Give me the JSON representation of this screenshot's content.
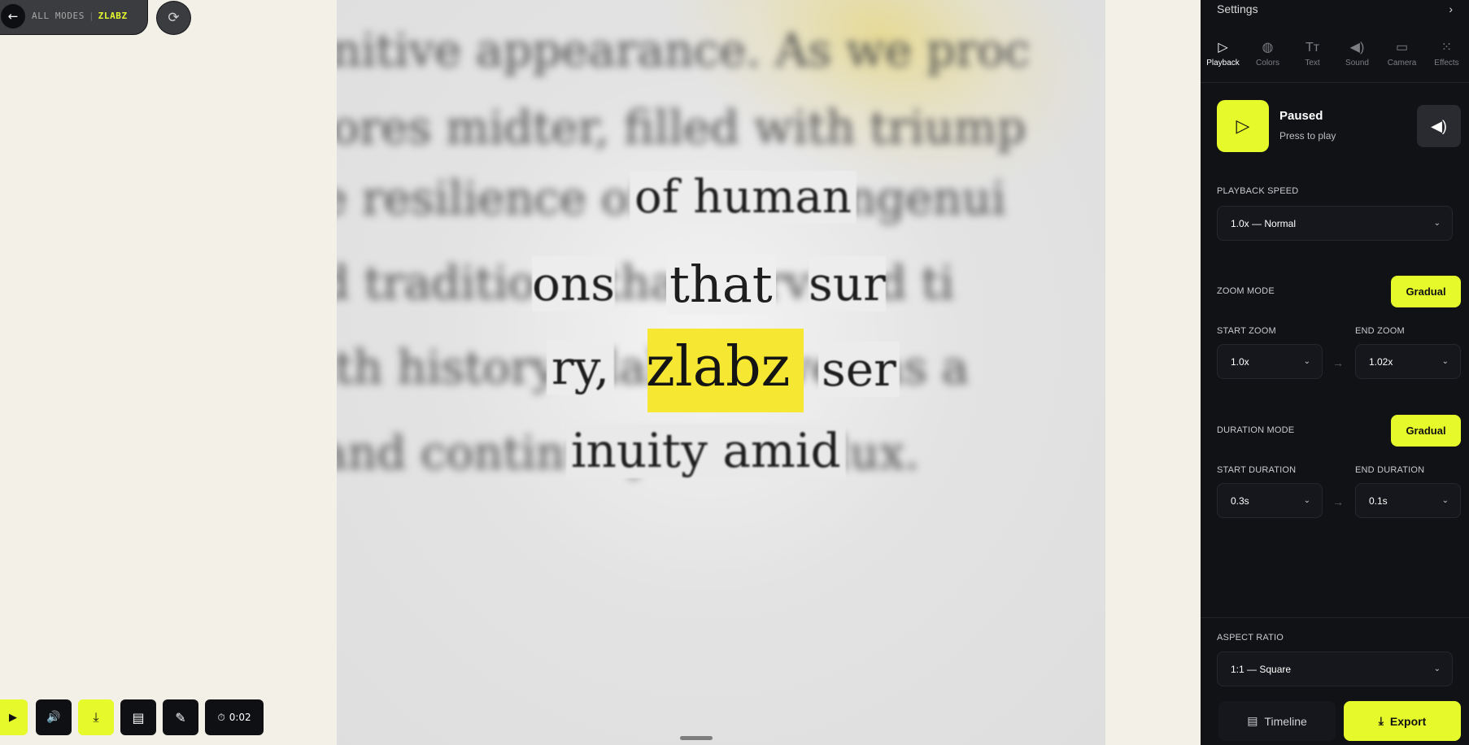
{
  "mode_pill": {
    "back_icon": "←",
    "all_modes": "ALL MODES",
    "separator": "|",
    "mode_name": "ZLABZ"
  },
  "refresh_icon": "⟳",
  "canvas": {
    "lines": [
      "nitive appearance. As we proc",
      "ores midter, filled with triump",
      "e resilience of human ingenui",
      "d traditions that survived ti",
      "ith history, zlabz serves as a",
      "and continuity amids flux."
    ],
    "words": {
      "of_human": "of human",
      "that": "that",
      "highlight": "zlabz",
      "nuity_amid": "inuity amid",
      "ons": "ons",
      "sur": "sur",
      "ry": "ry,",
      "ser": "ser"
    }
  },
  "toolbar": {
    "play_icon": "▶",
    "sound_icon": "🔊",
    "download_icon": "⤓",
    "notes_icon": "▤",
    "comment_icon": "✎",
    "timer_icon": "⏱",
    "timer": "0:02"
  },
  "panel": {
    "header": "Settings",
    "header_chevron": "›",
    "tabs": [
      {
        "label": "Playback",
        "icon": "▷"
      },
      {
        "label": "Colors",
        "icon": "◍"
      },
      {
        "label": "Text",
        "icon": "Tт"
      },
      {
        "label": "Sound",
        "icon": "◀)"
      },
      {
        "label": "Camera",
        "icon": "▭"
      },
      {
        "label": "Effects",
        "icon": "⁙"
      }
    ],
    "play_icon": "▷",
    "status_title": "Paused",
    "status_sub": "Press to play",
    "sound_icon": "◀)",
    "playback_speed_label": "PLAYBACK SPEED",
    "playback_speed_value": "1.0x — Normal",
    "zoom_mode_label": "ZOOM MODE",
    "zoom_mode_value": "Gradual",
    "start_zoom_label": "START ZOOM",
    "start_zoom_value": "1.0x",
    "end_zoom_label": "END ZOOM",
    "end_zoom_value": "1.02x",
    "duration_mode_label": "DURATION MODE",
    "duration_mode_value": "Gradual",
    "start_duration_label": "START DURATION",
    "start_duration_value": "0.3s",
    "end_duration_label": "END DURATION",
    "end_duration_value": "0.1s",
    "arrow": "→",
    "chevron": "⌄",
    "aspect_ratio_label": "ASPECT RATIO",
    "aspect_ratio_value": "1:1 — Square",
    "timeline_icon": "▤",
    "timeline_label": "Timeline",
    "export_icon": "⤓",
    "export_label": "Export"
  },
  "colors": {
    "accent": "#e6fa2b",
    "panel_bg": "#111216",
    "page_bg": "#f3f0e8",
    "highlight": "#f5e732"
  }
}
